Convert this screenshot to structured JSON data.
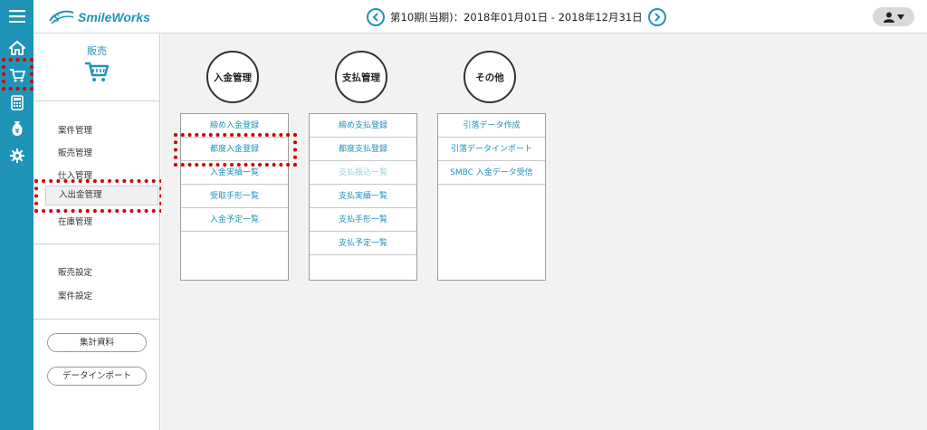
{
  "app": {
    "logo_text": "SmileWorks",
    "period": "第10期(当期)：2018年01月01日 - 2018年12月31日"
  },
  "rail": {
    "icons": [
      "menu-icon",
      "home-icon",
      "cart-icon",
      "calculator-icon",
      "money-bag-icon",
      "gear-icon"
    ]
  },
  "sidebar": {
    "title": "販売",
    "items": [
      {
        "label": "案件管理"
      },
      {
        "label": "販売管理"
      },
      {
        "label": "仕入管理"
      },
      {
        "label": "入出金管理"
      },
      {
        "label": "在庫管理"
      }
    ],
    "settings": [
      {
        "label": "販売設定"
      },
      {
        "label": "案件設定"
      }
    ],
    "buttons": [
      {
        "label": "集計資料"
      },
      {
        "label": "データインポート"
      }
    ]
  },
  "main": {
    "groups": [
      {
        "title": "入金管理",
        "items": [
          {
            "label": "締め入金登録"
          },
          {
            "label": "都度入金登録"
          },
          {
            "label": "入金実績一覧"
          },
          {
            "label": "受取手形一覧"
          },
          {
            "label": "入金予定一覧"
          }
        ]
      },
      {
        "title": "支払管理",
        "items": [
          {
            "label": "締め支払登録"
          },
          {
            "label": "都度支払登録"
          },
          {
            "label": "支払振込一覧"
          },
          {
            "label": "支払実績一覧"
          },
          {
            "label": "支払手形一覧"
          },
          {
            "label": "支払予定一覧"
          }
        ]
      },
      {
        "title": "その他",
        "items": [
          {
            "label": "引落データ作成"
          },
          {
            "label": "引落データインポート"
          },
          {
            "label": "SMBC 入金データ受信"
          }
        ]
      }
    ]
  },
  "colors": {
    "accent": "#1f93b8",
    "highlight": "#d40000"
  }
}
